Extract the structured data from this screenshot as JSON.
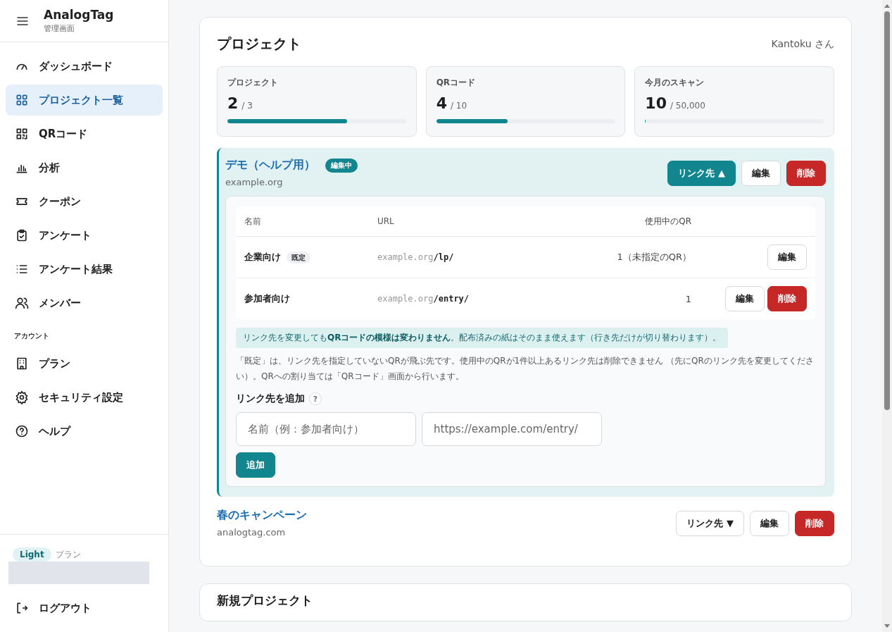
{
  "sidebar": {
    "brand": "AnalogTag",
    "subtitle": "管理画面",
    "items": [
      {
        "label": "ダッシュボード",
        "selected": false
      },
      {
        "label": "プロジェクト一覧",
        "selected": true
      },
      {
        "label": "QRコード",
        "selected": false
      },
      {
        "label": "分析",
        "selected": false
      },
      {
        "label": "クーポン",
        "selected": false
      },
      {
        "label": "アンケート",
        "selected": false
      },
      {
        "label": "アンケート結果",
        "selected": false
      },
      {
        "label": "メンバー",
        "selected": false
      }
    ],
    "section_label": "アカウント",
    "account_items": [
      {
        "label": "プラン",
        "selected": false
      },
      {
        "label": "セキュリティ設定",
        "selected": false
      },
      {
        "label": "ヘルプ",
        "selected": false
      }
    ],
    "plan": {
      "badge": "Light",
      "label": "プラン"
    },
    "logout": "ログアウト"
  },
  "page": {
    "title": "プロジェクト",
    "user": "Kantoku さん"
  },
  "stats": [
    {
      "label": "プロジェクト",
      "value": "2",
      "limit": "/ 3",
      "level": 0.67
    },
    {
      "label": "QRコード",
      "value": "4",
      "limit": "/ 10",
      "level": 0.4
    },
    {
      "label": "今月のスキャン",
      "value": "10",
      "limit": "/ 50,000",
      "level": 0.0002
    }
  ],
  "projects": [
    {
      "name": "デモ（ヘルプ用）",
      "badge": "編集中",
      "domain": "example.org",
      "expanded": true,
      "buttons": [
        {
          "label": "リンク先 ▲",
          "kind": "link"
        },
        {
          "label": "編集",
          "kind": "edit"
        },
        {
          "label": "削除",
          "kind": "delete"
        }
      ],
      "links": {
        "columns": [
          "名前",
          "URL",
          "使用中のQR"
        ],
        "rows": [
          {
            "name": "企業向け",
            "tag": "既定",
            "url_host": "example.org",
            "url_path": "/lp/",
            "qr_count": "1（未指定のQR）",
            "buttons": [
              {
                "label": "編集",
                "kind": "edit"
              }
            ]
          },
          {
            "name": "参加者向け",
            "url_host": "example.org",
            "url_path": "/entry/",
            "qr_count": "1",
            "buttons": [
              {
                "label": "編集",
                "kind": "edit"
              },
              {
                "label": "削除",
                "kind": "delete"
              }
            ]
          }
        ],
        "notice": "リンク先を変更しても**QRコードの模様は変わりません**。配布済みの紙はそのまま使えます（行き先だけが切り替わります）。",
        "help_text": "「既定」は、リンク先を指定していないQRが飛ぶ先です。使用中のQRが1件以上あるリンク先は削除できません （先にQRのリンク先を変更してください）。QRへの割り当ては「QRコード」画面から行います。",
        "add_form": {
          "title": "リンク先を追加",
          "help": "?",
          "name_placeholder": "名前（例：参加者向け）",
          "url_placeholder": "https://example.com/entry/",
          "submit": "追加"
        }
      }
    },
    {
      "name": "春のキャンペーン",
      "domain": "analogtag.com",
      "expanded": false,
      "buttons": [
        {
          "label": "リンク先 ▼",
          "kind": "link"
        },
        {
          "label": "編集",
          "kind": "edit"
        },
        {
          "label": "削除",
          "kind": "delete"
        }
      ]
    }
  ],
  "new_project": {
    "title": "新規プロジェクト"
  }
}
